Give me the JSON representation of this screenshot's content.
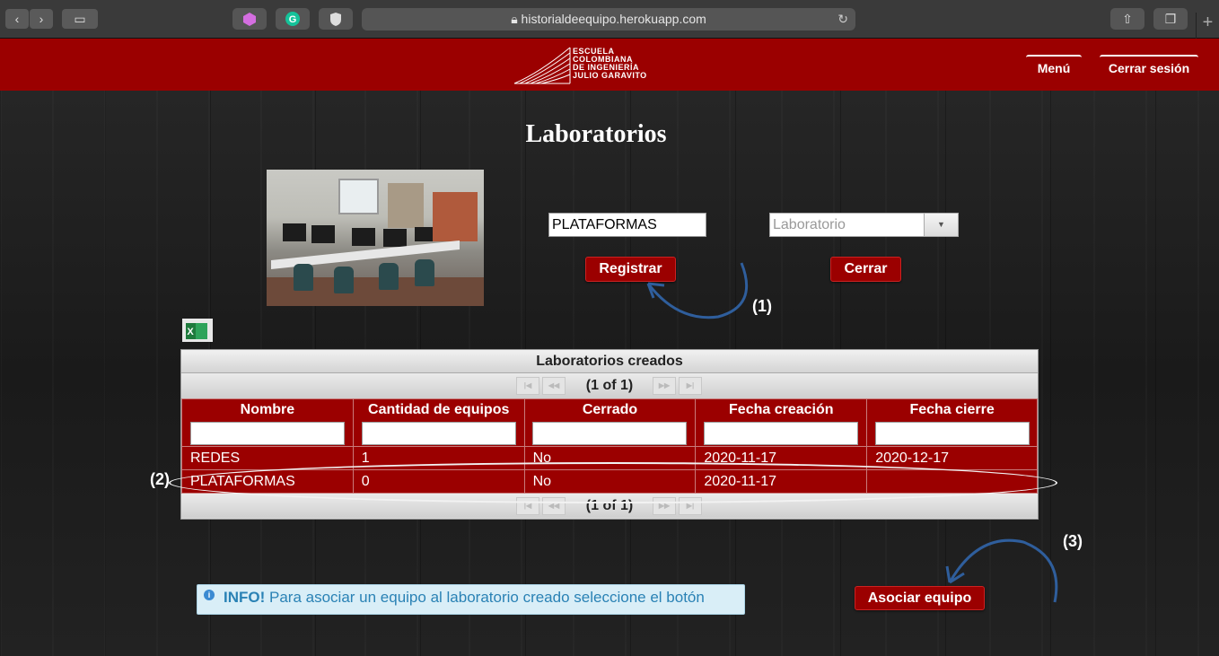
{
  "browser": {
    "url": "historialdeequipo.herokuapp.com",
    "back_icon": "chevron-left-icon",
    "forward_icon": "chevron-right-icon",
    "sidebar_icon": "sidebar-icon",
    "share_icon": "share-icon",
    "tabs_icon": "tabs-icon",
    "new_tab": "+"
  },
  "header": {
    "logo_lines": [
      "Escuela",
      "Colombiana",
      "de Ingeniería",
      "Julio Garavito"
    ],
    "menu_label": "Menú",
    "logout_label": "Cerrar sesión",
    "brand_color": "#9b0000"
  },
  "page": {
    "title": "Laboratorios"
  },
  "form": {
    "name_value": "PLATAFORMAS",
    "select_placeholder": "Laboratorio",
    "register_label": "Registrar",
    "close_label": "Cerrar"
  },
  "annotations": {
    "a1": "(1)",
    "a2": "(2)",
    "a3": "(3)"
  },
  "table": {
    "caption": "Laboratorios creados",
    "page_report": "(1 of 1)",
    "columns": [
      "Nombre",
      "Cantidad de equipos",
      "Cerrado",
      "Fecha creación",
      "Fecha cierre"
    ],
    "rows": [
      [
        "REDES",
        "1",
        "No",
        "2020-11-17",
        "2020-12-17"
      ],
      [
        "PLATAFORMAS",
        "0",
        "No",
        "2020-11-17",
        ""
      ]
    ]
  },
  "info": {
    "label": "INFO!",
    "message": " Para asociar un equipo al laboratorio creado seleccione el botón"
  },
  "associate_label": "Asociar equipo"
}
